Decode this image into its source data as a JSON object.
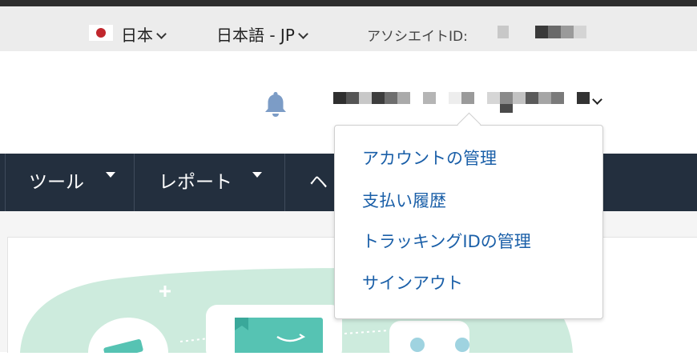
{
  "locale_bar": {
    "country": "日本",
    "language": "日本語 - JP",
    "associate_id_label": "アソシエイトID:",
    "flag_colors": {
      "field": "#ffffff",
      "disc": "#c1272d"
    }
  },
  "header": {
    "notification_icon": "bell-icon",
    "account_menu_icon": "chevron-down-icon"
  },
  "nav": {
    "items": [
      {
        "label": "ツール"
      },
      {
        "label": "レポート"
      },
      {
        "label": "ヘ"
      }
    ],
    "background": "#232f3e"
  },
  "account_dropdown": {
    "items": [
      {
        "label": "アカウントの管理"
      },
      {
        "label": "支払い履歴"
      },
      {
        "label": "トラッキングIDの管理"
      },
      {
        "label": "サインアウト"
      }
    ],
    "link_color": "#1a5fa8"
  }
}
